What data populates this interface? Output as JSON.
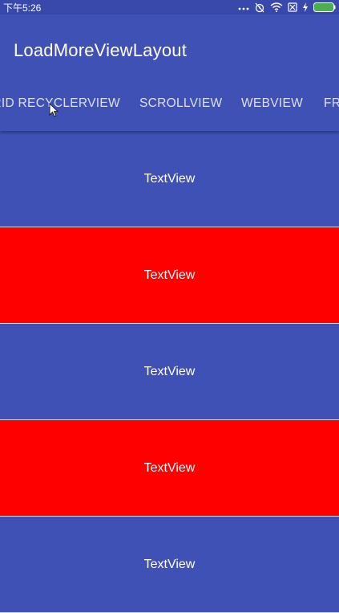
{
  "status_bar": {
    "time": "下午5:26",
    "icons": [
      "more-dots-icon",
      "alarm-icon",
      "wifi-icon",
      "sim-icon",
      "charging-icon",
      "battery-icon"
    ],
    "battery_color": "#4CAF50"
  },
  "app_bar": {
    "title": "LoadMoreViewLayout",
    "background": "#3F51B5"
  },
  "tabs": [
    {
      "label": "GRID RECYCLERVIEW"
    },
    {
      "label": "SCROLLVIEW"
    },
    {
      "label": "WEBVIEW"
    },
    {
      "label": "FR"
    }
  ],
  "list": {
    "rows": [
      {
        "text": "TextView",
        "color": "#3F51B5"
      },
      {
        "text": "TextView",
        "color": "#FF0000"
      },
      {
        "text": "TextView",
        "color": "#3F51B5"
      },
      {
        "text": "TextView",
        "color": "#FF0000"
      },
      {
        "text": "TextView",
        "color": "#3F51B5"
      }
    ]
  }
}
